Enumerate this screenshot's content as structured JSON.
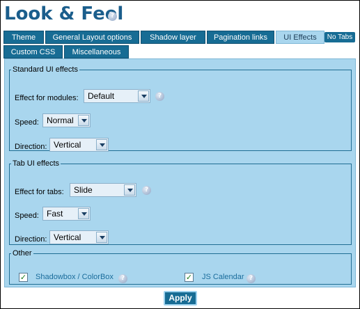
{
  "title": "Look & Feel",
  "help_glyph": "?",
  "tabs": [
    {
      "label": "Theme"
    },
    {
      "label": "General Layout options"
    },
    {
      "label": "Shadow layer"
    },
    {
      "label": "Pagination links"
    },
    {
      "label": "UI Effects"
    },
    {
      "label": "Custom CSS"
    },
    {
      "label": "Miscellaneous"
    }
  ],
  "no_tabs": "No Tabs",
  "standard": {
    "legend": "Standard UI effects",
    "effect_label": "Effect for modules:",
    "effect_value": "Default",
    "speed_label": "Speed:",
    "speed_value": "Normal",
    "direction_label": "Direction:",
    "direction_value": "Vertical"
  },
  "tabui": {
    "legend": "Tab UI effects",
    "effect_label": "Effect for tabs:",
    "effect_value": "Slide",
    "speed_label": "Speed:",
    "speed_value": "Fast",
    "direction_label": "Direction:",
    "direction_value": "Vertical"
  },
  "other": {
    "legend": "Other",
    "shadowbox_label": "Shadowbox / ColorBox",
    "shadowbox_checked": true,
    "jscal_label": "JS Calendar",
    "jscal_checked": true
  },
  "apply_label": "Apply",
  "colors": {
    "accent": "#176c94",
    "panel": "#a9d6ee",
    "title": "#1b5e8c"
  }
}
